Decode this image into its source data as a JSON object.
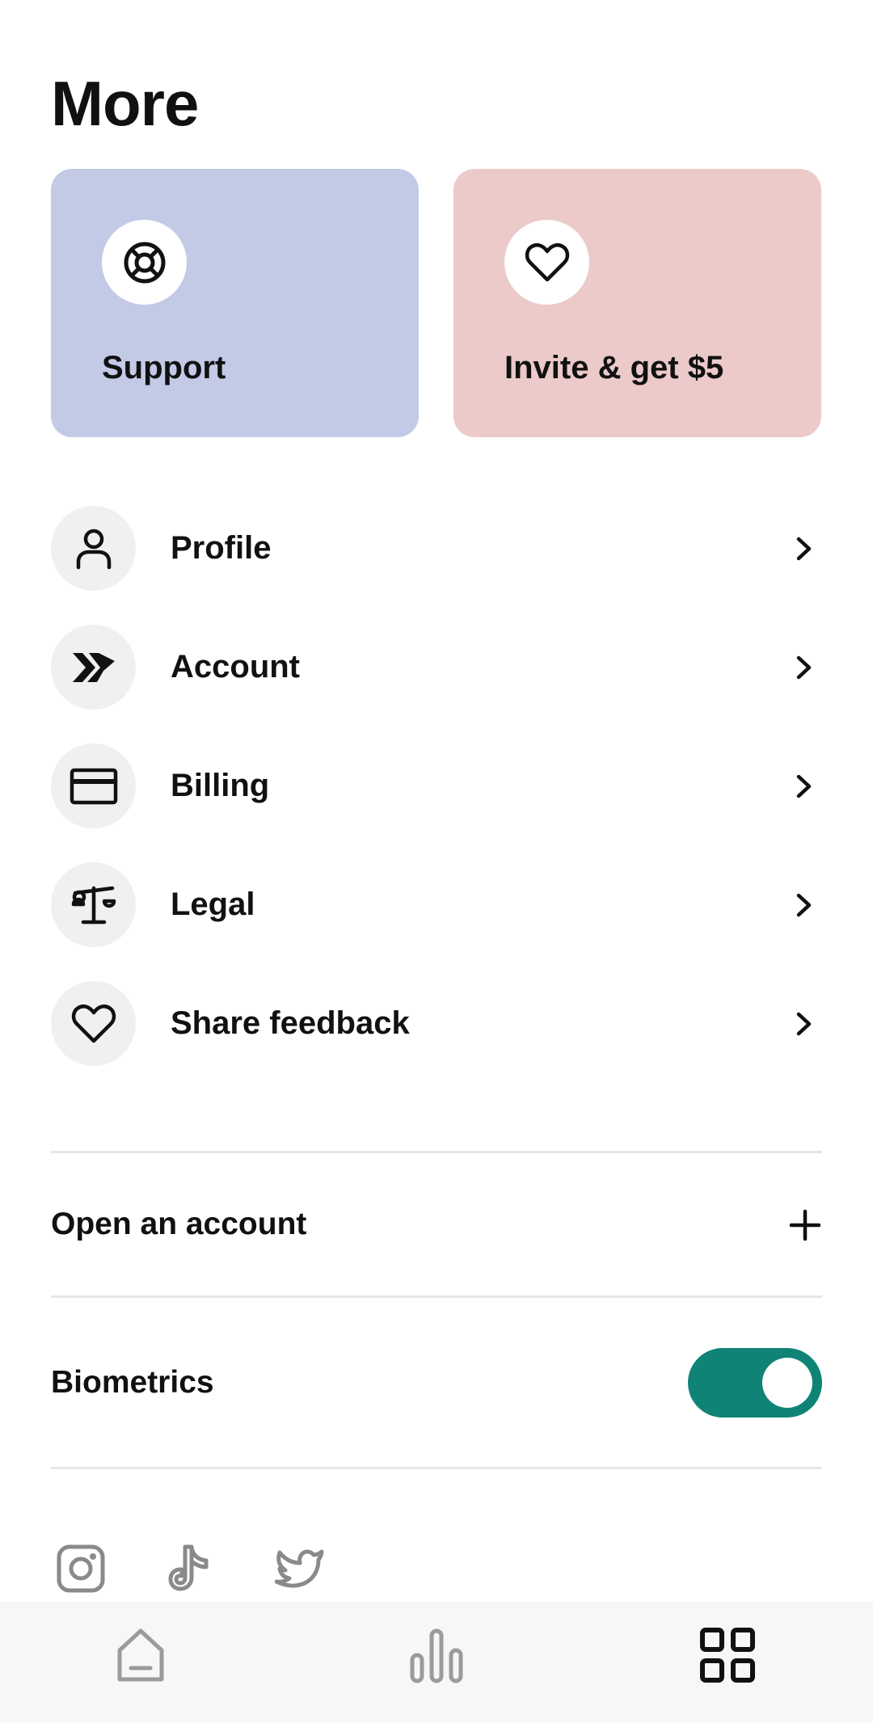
{
  "page": {
    "title": "More"
  },
  "cards": {
    "support": {
      "label": "Support",
      "icon": "lifebuoy-icon",
      "color": "#c2cae6"
    },
    "invite": {
      "label": "Invite & get $5",
      "icon": "heart-icon",
      "color": "#eccaca"
    }
  },
  "menu": {
    "items": [
      {
        "label": "Profile",
        "icon": "person-icon"
      },
      {
        "label": "Account",
        "icon": "double-chevron-icon"
      },
      {
        "label": "Billing",
        "icon": "credit-card-icon"
      },
      {
        "label": "Legal",
        "icon": "scales-icon"
      },
      {
        "label": "Share feedback",
        "icon": "heart-icon"
      }
    ]
  },
  "open_account": {
    "label": "Open an account",
    "icon": "plus-icon"
  },
  "biometrics": {
    "label": "Biometrics",
    "enabled": true,
    "accent": "#0f8476"
  },
  "social": {
    "icons": [
      "instagram-icon",
      "tiktok-icon",
      "twitter-icon"
    ]
  },
  "bottom_nav": {
    "items": [
      {
        "icon": "home-icon",
        "active": false
      },
      {
        "icon": "bar-chart-icon",
        "active": false
      },
      {
        "icon": "grid-icon",
        "active": true
      }
    ]
  }
}
